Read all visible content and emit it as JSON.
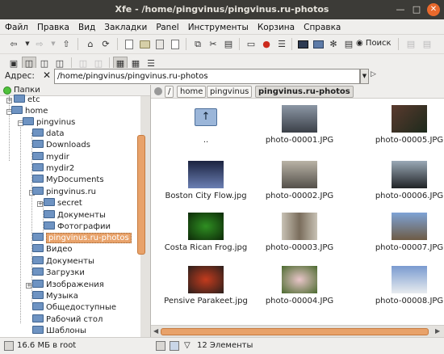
{
  "window": {
    "title": "Xfe - /home/pingvinus/pingvinus.ru-photos"
  },
  "menubar": [
    "Файл",
    "Правка",
    "Вид",
    "Закладки",
    "Panel",
    "Инструменты",
    "Корзина",
    "Справка"
  ],
  "toolbar": {
    "search_label": "Поиск"
  },
  "address": {
    "label": "Адрес:",
    "value": "/home/pingvinus/pingvinus.ru-photos"
  },
  "tree": {
    "header": "Папки",
    "items": [
      {
        "label": "etc"
      },
      {
        "label": "home"
      },
      {
        "label": "pingvinus"
      },
      {
        "label": "data"
      },
      {
        "label": "Downloads"
      },
      {
        "label": "mydir"
      },
      {
        "label": "mydir2"
      },
      {
        "label": "MyDocuments"
      },
      {
        "label": "pingvinus.ru"
      },
      {
        "label": "secret"
      },
      {
        "label": "Документы"
      },
      {
        "label": "Фотографии"
      },
      {
        "label": "pingvinus.ru-photos"
      },
      {
        "label": "Видео"
      },
      {
        "label": "Документы"
      },
      {
        "label": "Загрузки"
      },
      {
        "label": "Изображения"
      },
      {
        "label": "Музыка"
      },
      {
        "label": "Общедоступные"
      },
      {
        "label": "Рабочий стол"
      },
      {
        "label": "Шаблоны"
      }
    ]
  },
  "breadcrumbs": [
    "/",
    "home",
    "pingvinus",
    "pingvinus.ru-photos"
  ],
  "files": [
    {
      "name": "..",
      "kind": "parent-dir"
    },
    {
      "name": "photo-00001.JPG",
      "colors": [
        "#8c97a5",
        "#3b4048"
      ]
    },
    {
      "name": "photo-00005.JPG",
      "colors": [
        "#5a3a2e",
        "#1d2a1c"
      ]
    },
    {
      "name": "Boston City Flow.jpg",
      "colors": [
        "#1b2340",
        "#6b7fb3"
      ]
    },
    {
      "name": "photo-00002.JPG",
      "colors": [
        "#b9b3a6",
        "#54504a"
      ]
    },
    {
      "name": "photo-00006.JPG",
      "colors": [
        "#9aa9b6",
        "#202326"
      ]
    },
    {
      "name": "Costa Rican Frog.jpg",
      "colors": [
        "#2f8f22",
        "#0d2a08"
      ]
    },
    {
      "name": "photo-00003.JPG",
      "colors": [
        "#7a6d5c",
        "#c8c2b5"
      ]
    },
    {
      "name": "photo-00007.JPG",
      "colors": [
        "#7ea3d6",
        "#6e5b45"
      ]
    },
    {
      "name": "Pensive Parakeet.jpg",
      "colors": [
        "#c33b1d",
        "#2a1f1c"
      ]
    },
    {
      "name": "photo-00004.JPG",
      "colors": [
        "#e9c5c9",
        "#4a6a2e"
      ]
    },
    {
      "name": "photo-00008.JPG",
      "colors": [
        "#7a9bd0",
        "#e8ecef"
      ]
    }
  ],
  "status": {
    "free": "16.6 МБ в root",
    "count": "12 Элементы"
  },
  "colors": {
    "accent": "#e8a26a",
    "folder": "#6e93c2",
    "titlebar": "#3c3b37"
  }
}
